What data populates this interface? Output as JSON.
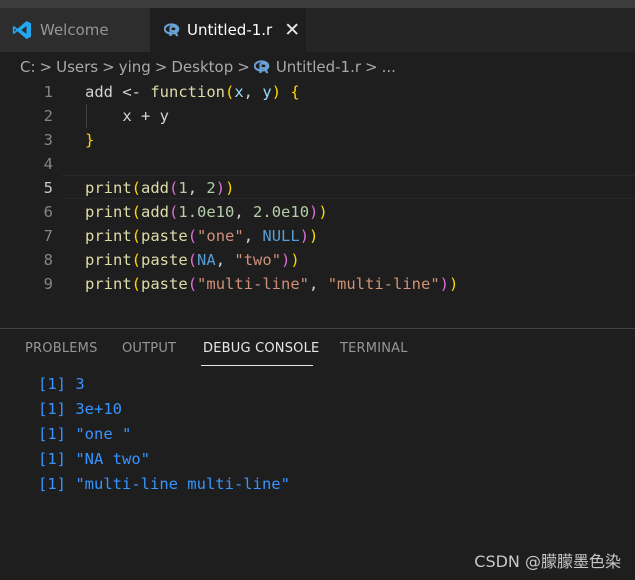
{
  "tabs": {
    "welcome_label": "Welcome",
    "active_label": "Untitled-1.r",
    "close_glyph": "✕"
  },
  "breadcrumb": {
    "parts": [
      "C:",
      "Users",
      "ying",
      "Desktop",
      "Untitled-1.r",
      "..."
    ],
    "separator": ">"
  },
  "editor": {
    "active_line": 5,
    "lines": [
      {
        "num": "1",
        "tokens": [
          [
            "add",
            "d"
          ],
          [
            " <- ",
            "d"
          ],
          [
            "function",
            "k"
          ],
          [
            "(",
            "b1"
          ],
          [
            "x",
            "p"
          ],
          [
            ", ",
            "d"
          ],
          [
            "y",
            "p"
          ],
          [
            ")",
            "b1"
          ],
          [
            " ",
            "d"
          ],
          [
            "{",
            "b1"
          ]
        ]
      },
      {
        "num": "2",
        "tokens": [
          [
            "    x + y",
            "d"
          ]
        ]
      },
      {
        "num": "3",
        "tokens": [
          [
            "}",
            "b1"
          ]
        ]
      },
      {
        "num": "4",
        "tokens": []
      },
      {
        "num": "5",
        "tokens": [
          [
            "print",
            "k"
          ],
          [
            "(",
            "b1"
          ],
          [
            "add",
            "k"
          ],
          [
            "(",
            "b2"
          ],
          [
            "1",
            "n"
          ],
          [
            ", ",
            "d"
          ],
          [
            "2",
            "n"
          ],
          [
            ")",
            "b2"
          ],
          [
            ")",
            "b1"
          ]
        ]
      },
      {
        "num": "6",
        "tokens": [
          [
            "print",
            "k"
          ],
          [
            "(",
            "b1"
          ],
          [
            "add",
            "k"
          ],
          [
            "(",
            "b2"
          ],
          [
            "1.0e10",
            "n"
          ],
          [
            ", ",
            "d"
          ],
          [
            "2.0e10",
            "n"
          ],
          [
            ")",
            "b2"
          ],
          [
            ")",
            "b1"
          ]
        ]
      },
      {
        "num": "7",
        "tokens": [
          [
            "print",
            "k"
          ],
          [
            "(",
            "b1"
          ],
          [
            "paste",
            "k"
          ],
          [
            "(",
            "b2"
          ],
          [
            "\"one\"",
            "s"
          ],
          [
            ", ",
            "d"
          ],
          [
            "NULL",
            "c"
          ],
          [
            ")",
            "b2"
          ],
          [
            ")",
            "b1"
          ]
        ]
      },
      {
        "num": "8",
        "tokens": [
          [
            "print",
            "k"
          ],
          [
            "(",
            "b1"
          ],
          [
            "paste",
            "k"
          ],
          [
            "(",
            "b2"
          ],
          [
            "NA",
            "c"
          ],
          [
            ", ",
            "d"
          ],
          [
            "\"two\"",
            "s"
          ],
          [
            ")",
            "b2"
          ],
          [
            ")",
            "b1"
          ]
        ]
      },
      {
        "num": "9",
        "tokens": [
          [
            "print",
            "k"
          ],
          [
            "(",
            "b1"
          ],
          [
            "paste",
            "k"
          ],
          [
            "(",
            "b2"
          ],
          [
            "\"multi-line\"",
            "s"
          ],
          [
            ", ",
            "d"
          ],
          [
            "\"multi-line\"",
            "s"
          ],
          [
            ")",
            "b2"
          ],
          [
            ")",
            "b1"
          ]
        ]
      }
    ]
  },
  "panel": {
    "tabs": [
      "PROBLEMS",
      "OUTPUT",
      "DEBUG CONSOLE",
      "TERMINAL"
    ],
    "active_tab": "DEBUG CONSOLE",
    "console_lines": [
      "[1] 3",
      "[1] 3e+10",
      "[1] \"one \"",
      "[1] \"NA two\"",
      "[1] \"multi-line multi-line\""
    ]
  },
  "watermark": "CSDN @朦朦墨色染",
  "colors": {
    "background": "#1e1e1e",
    "console_text": "#3794ff",
    "function_name": "#dcdcaa",
    "string": "#ce9178",
    "number": "#b5cea8",
    "constant": "#569cd6",
    "bracket_level1": "#ffd700",
    "bracket_level2": "#da70d6"
  }
}
